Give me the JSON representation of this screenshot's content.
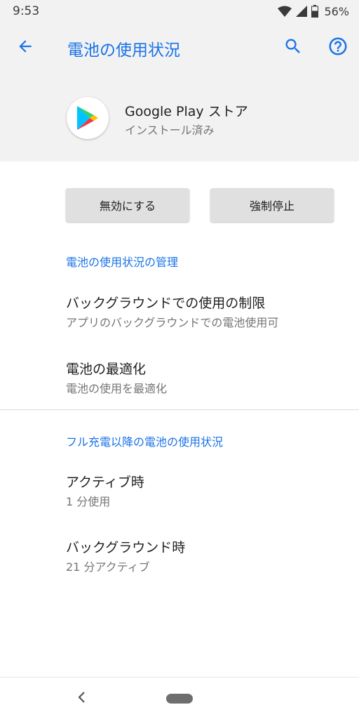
{
  "status_bar": {
    "time": "9:53",
    "battery_percent": "56%",
    "icons": [
      "wifi-icon",
      "cell-signal-icon",
      "battery-icon"
    ]
  },
  "app_bar": {
    "title": "電池の使用状況",
    "icons": [
      "arrow-back-icon",
      "search-icon",
      "help-icon"
    ]
  },
  "app_info": {
    "name": "Google Play ストア",
    "status": "インストール済み",
    "icon": "google-play-icon"
  },
  "actions": {
    "disable_label": "無効にする",
    "force_stop_label": "強制停止"
  },
  "sections": {
    "management": {
      "header": "電池の使用状況の管理",
      "items": [
        {
          "title": "バックグラウンドでの使用の制限",
          "summary": "アプリのバックグラウンドでの電池使用可"
        },
        {
          "title": "電池の最適化",
          "summary": "電池の使用を最適化"
        }
      ]
    },
    "since_full_charge": {
      "header": "フル充電以降の電池の使用状況",
      "items": [
        {
          "title": "アクティブ時",
          "summary": "1 分使用"
        },
        {
          "title": "バックグラウンド時",
          "summary": "21 分アクティブ"
        }
      ]
    }
  },
  "colors": {
    "accent": "#1a73e8",
    "background_header": "#f2f2f2",
    "button": "#e0e0e0"
  }
}
